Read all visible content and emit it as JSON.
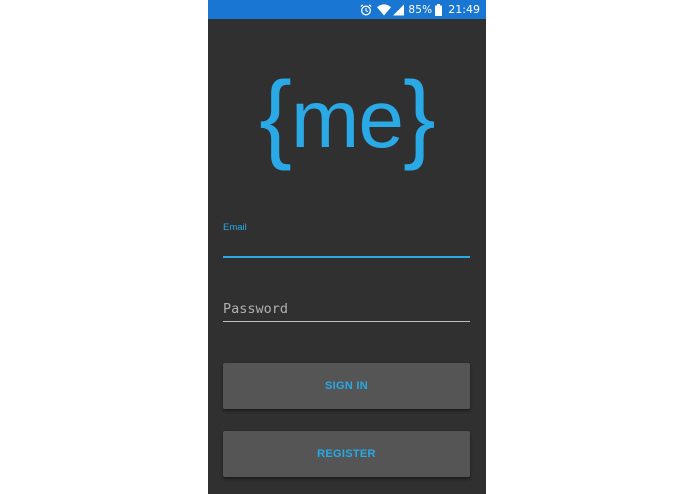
{
  "status_bar": {
    "battery_percent": "85%",
    "time": "21:49",
    "icons": [
      "alarm-icon",
      "wifi-icon",
      "signal-icon",
      "battery-icon"
    ],
    "background_color": "#1976d2"
  },
  "logo": {
    "open_brace": "{",
    "text": "me",
    "close_brace": "}",
    "color": "#29a9e6"
  },
  "form": {
    "email_label": "Email",
    "email_value": "",
    "password_placeholder": "Password",
    "password_value": ""
  },
  "buttons": {
    "sign_in": "SIGN IN",
    "register": "REGISTER"
  },
  "theme": {
    "background": "#303030",
    "accent": "#29a9e6",
    "button_background": "#555555"
  }
}
